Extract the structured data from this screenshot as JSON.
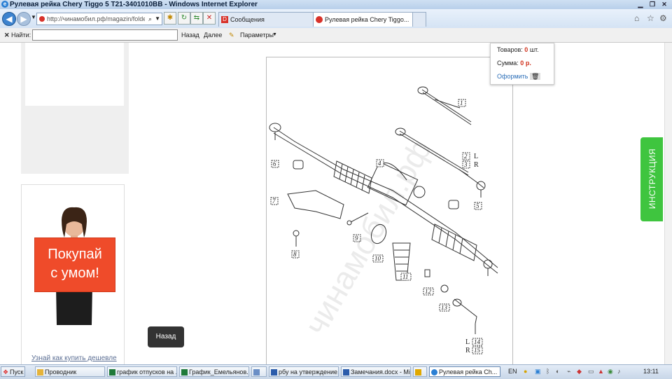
{
  "window": {
    "title": "Рулевая рейка Chery Tiggo 5 T21-3401010BB - Windows Internet Explorer"
  },
  "browser": {
    "address": "http://чинамобил.рф/magazin/folder/rul",
    "tabs": [
      {
        "label": "Сообщения"
      },
      {
        "label": "Рулевая рейка Chery Tiggo..."
      }
    ]
  },
  "findbar": {
    "find_label": "Найти:",
    "back_label": "Назад",
    "next_label": "Далее",
    "params_label": "Параметры"
  },
  "page": {
    "promo_sign_line1": "Покупай",
    "promo_sign_line2": "с умом!",
    "promo_link": "Узнай как купить дешевле",
    "tooltip": "Назад",
    "instruction_tab": "ИНСТРУКЦИЯ",
    "watermark": "чинамобил.рф"
  },
  "cart": {
    "items_label": "Товаров:",
    "items_value": "0",
    "items_unit": "шт.",
    "sum_label": "Сумма:",
    "sum_value": "0",
    "sum_unit": "р.",
    "checkout_label": "Оформить"
  },
  "diagram": {
    "callouts": [
      "1",
      "2",
      "3",
      "4",
      "5",
      "6",
      "7",
      "8",
      "9",
      "10",
      "11",
      "12",
      "13",
      "14",
      "15"
    ],
    "side_labels": [
      "L",
      "R",
      "L",
      "R"
    ]
  },
  "taskbar": {
    "start_label": "Пуск",
    "items": [
      {
        "label": "Проводник"
      },
      {
        "label": "график отпусков на ..."
      },
      {
        "label": "График_Емельянов...."
      },
      {
        "label": ""
      },
      {
        "label": "рбу на утверждение..."
      },
      {
        "label": "Замечания.docx - Mi..."
      },
      {
        "label": ""
      },
      {
        "label": "Рулевая рейка Ch..."
      }
    ],
    "lang": "EN",
    "clock": "13:11"
  }
}
